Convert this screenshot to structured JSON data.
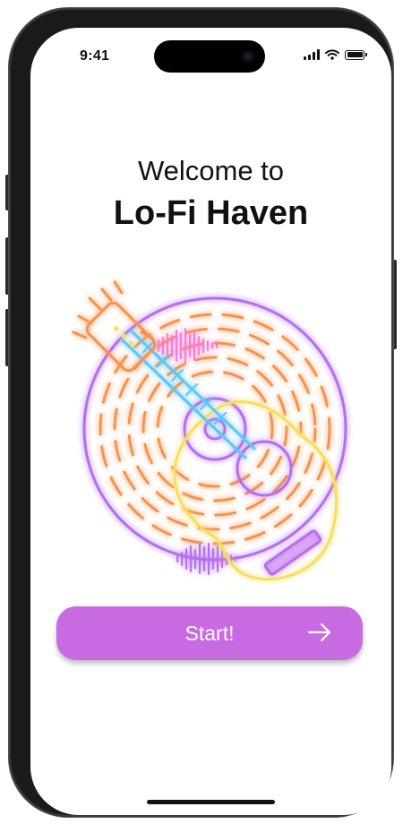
{
  "status_bar": {
    "time": "9:41"
  },
  "welcome": {
    "line1": "Welcome to",
    "app_name": "Lo-Fi Haven"
  },
  "start_button": {
    "label": "Start!"
  },
  "icons": {
    "arrow": "arrow-right-icon",
    "illustration": "neon-guitar-record-illustration"
  },
  "colors": {
    "accent": "#c86ae2",
    "neon_purple": "#b46ef0",
    "neon_orange": "#f7934f",
    "neon_yellow": "#f8de5b",
    "neon_blue": "#5cc8f5",
    "neon_pink": "#f77bd9"
  }
}
